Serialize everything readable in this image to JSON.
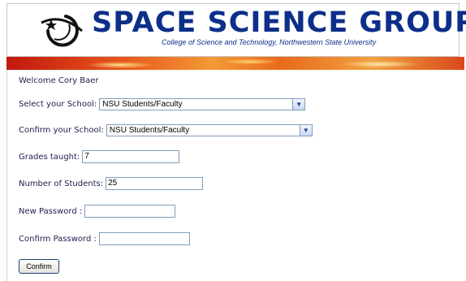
{
  "header": {
    "brand": "SPACE SCIENCE GROUP",
    "subtitle": "College of Science and Technology, Northwestern State University",
    "logo_icon": "moon-orbit-logo-icon"
  },
  "form": {
    "welcome": "Welcome Cory Baer",
    "select_school_label": "Select your School:",
    "select_school_value": "NSU Students/Faculty",
    "confirm_school_label": "Confirm your School:",
    "confirm_school_value": "NSU Students/Faculty",
    "grades_label": "Grades taught:",
    "grades_value": "7",
    "students_label": "Number of Students:",
    "students_value": "25",
    "new_password_label": "New Password :",
    "new_password_value": "",
    "confirm_password_label": "Confirm Password :",
    "confirm_password_value": "",
    "confirm_button": "Confirm"
  },
  "colors": {
    "brand": "#0d2f8a",
    "label_text": "#1d1d50",
    "input_border": "#7f9db9"
  }
}
